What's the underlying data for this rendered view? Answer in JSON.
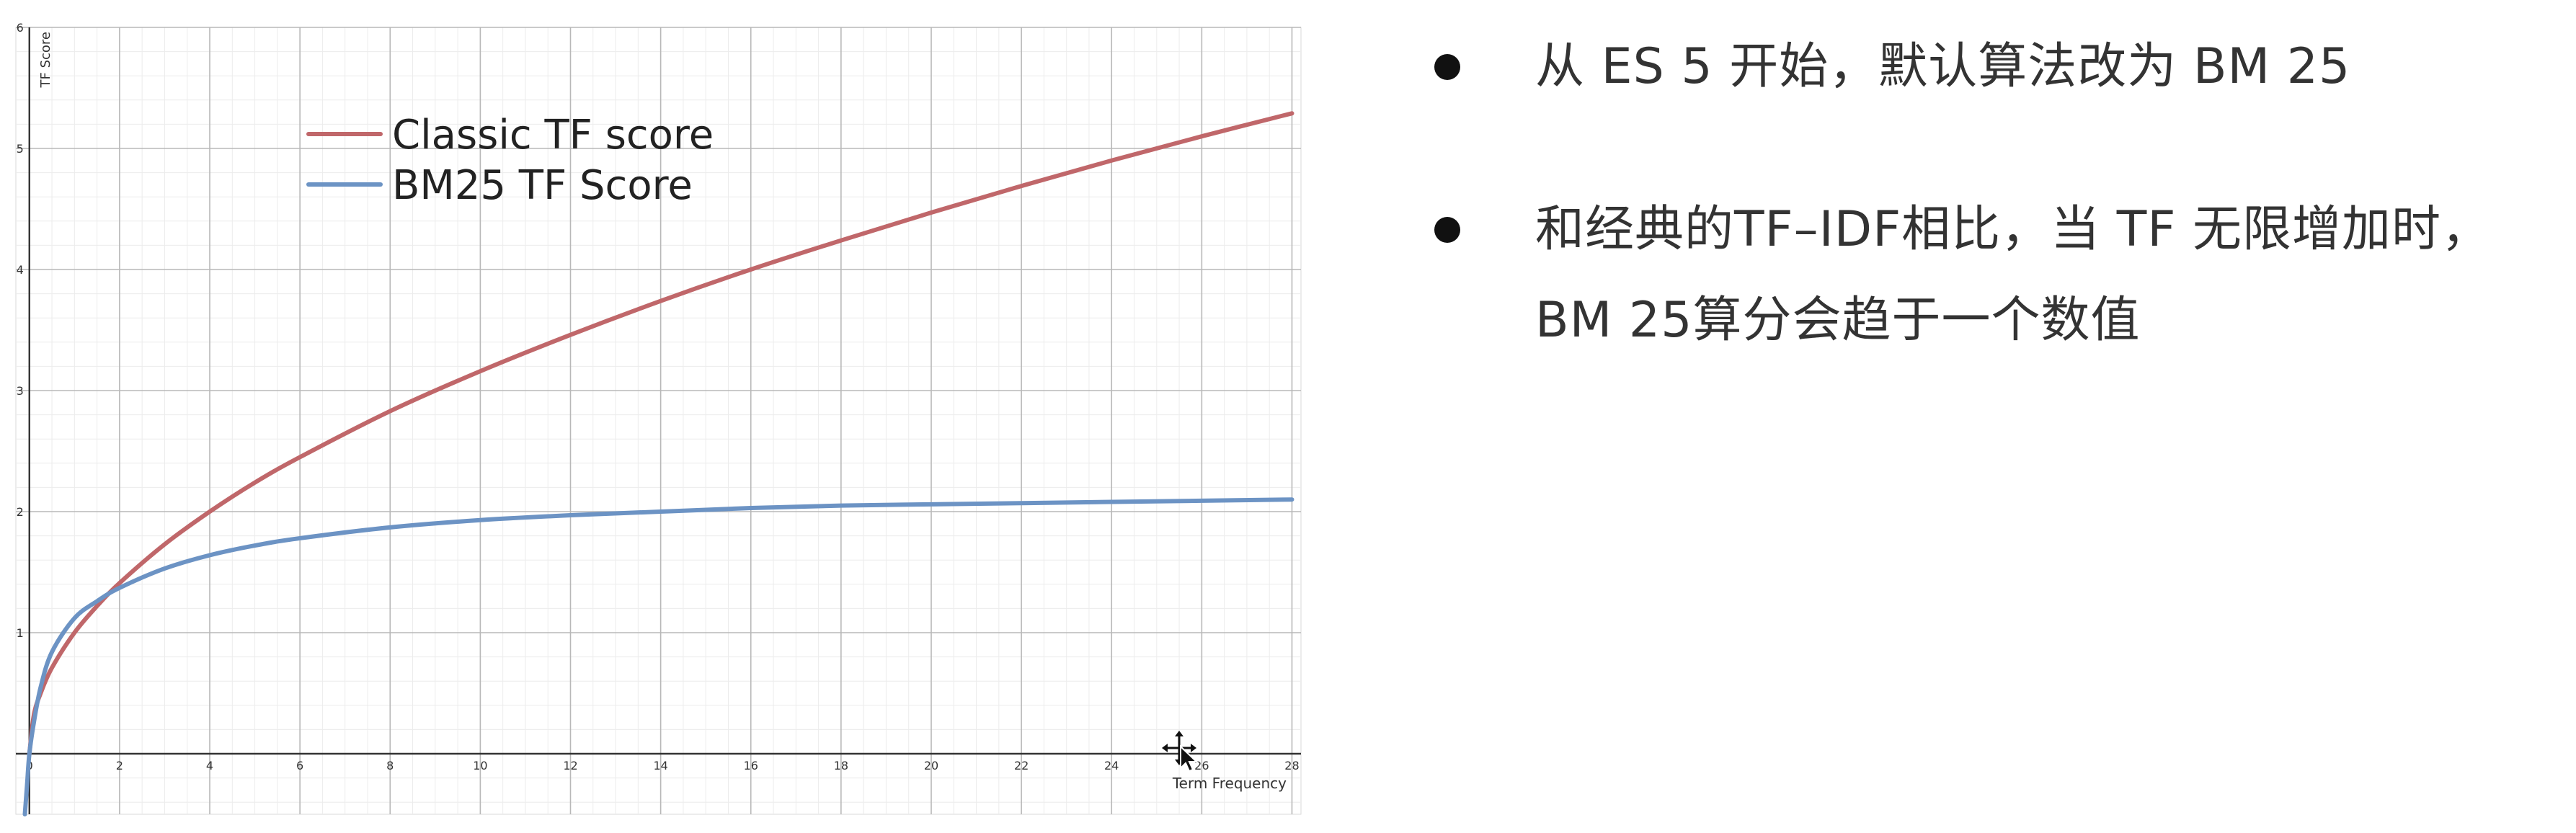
{
  "chart_data": {
    "type": "line",
    "title": "",
    "xlabel": "Term Frequency",
    "ylabel": "TF Score",
    "xlim": [
      -0.3,
      28.2
    ],
    "ylim": [
      -0.5,
      6.0
    ],
    "x_ticks": [
      0,
      2,
      4,
      6,
      8,
      10,
      12,
      14,
      16,
      18,
      20,
      22,
      24,
      26,
      28
    ],
    "y_ticks": [
      1,
      2,
      3,
      4,
      5,
      6
    ],
    "grid": true,
    "legend_position": "top-left",
    "series": [
      {
        "name": "Classic TF score",
        "color": "#c0676a",
        "x": [
          0,
          0.1,
          0.25,
          0.5,
          1,
          1.5,
          2,
          3,
          4,
          5,
          6,
          8,
          10,
          12,
          14,
          16,
          18,
          20,
          22,
          24,
          26,
          28
        ],
        "y": [
          0,
          0.32,
          0.5,
          0.71,
          1.0,
          1.22,
          1.41,
          1.73,
          2.0,
          2.24,
          2.45,
          2.83,
          3.16,
          3.46,
          3.74,
          4.0,
          4.24,
          4.47,
          4.69,
          4.9,
          5.1,
          5.29
        ]
      },
      {
        "name": "BM25 TF Score",
        "color": "#6c93c4",
        "x": [
          -0.1,
          -0.05,
          0,
          0.1,
          0.25,
          0.5,
          1,
          1.5,
          2,
          3,
          4,
          5,
          6,
          8,
          10,
          12,
          14,
          16,
          18,
          20,
          22,
          24,
          26,
          28
        ],
        "y": [
          -0.5,
          -0.25,
          0,
          0.26,
          0.55,
          0.84,
          1.12,
          1.26,
          1.37,
          1.53,
          1.64,
          1.72,
          1.78,
          1.87,
          1.93,
          1.97,
          2.0,
          2.03,
          2.05,
          2.06,
          2.07,
          2.08,
          2.09,
          2.1
        ]
      }
    ]
  },
  "bullets": {
    "line1": "从 ES 5 开始，默认算法改为 BM 25",
    "line2a": "和经典的TF–IDF相比，当 TF 无限增加时，",
    "line2b": "BM 25算分会趋于一个数值"
  },
  "cursor_icon": "move-cursor-icon"
}
